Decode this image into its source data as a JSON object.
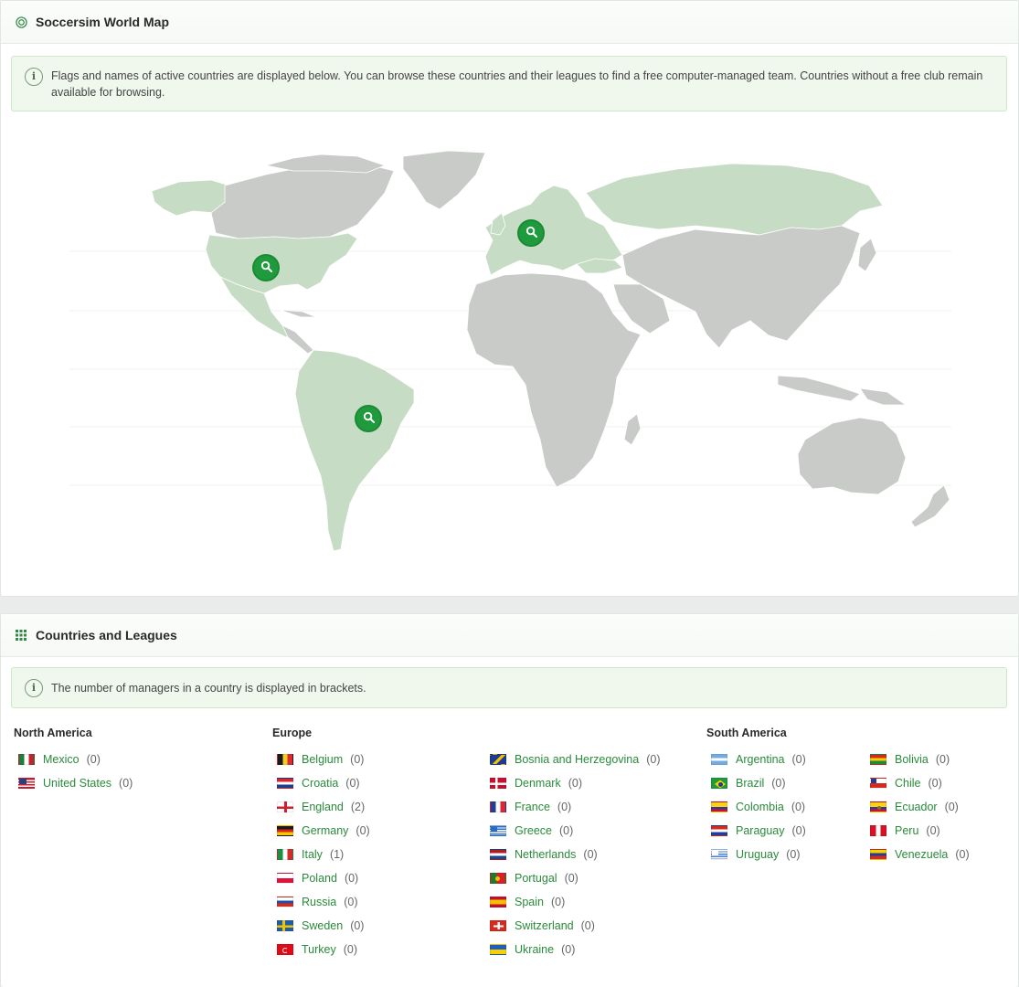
{
  "map_card": {
    "title": "Soccersim World Map",
    "info": "Flags and names of active countries are displayed below. You can browse these countries and their leagues to find a free computer-managed team. Countries without a free club remain available for browsing."
  },
  "list_card": {
    "title": "Countries and Leagues",
    "info": "The number of managers in a country is displayed in brackets."
  },
  "regions": {
    "north_america": {
      "title": "North America"
    },
    "europe": {
      "title": "Europe"
    },
    "south_america": {
      "title": "South America"
    }
  },
  "countries": {
    "mexico": {
      "name": "Mexico",
      "count": "(0)"
    },
    "united_states": {
      "name": "United States",
      "count": "(0)"
    },
    "belgium": {
      "name": "Belgium",
      "count": "(0)"
    },
    "croatia": {
      "name": "Croatia",
      "count": "(0)"
    },
    "england": {
      "name": "England",
      "count": "(2)"
    },
    "germany": {
      "name": "Germany",
      "count": "(0)"
    },
    "italy": {
      "name": "Italy",
      "count": "(1)"
    },
    "poland": {
      "name": "Poland",
      "count": "(0)"
    },
    "russia": {
      "name": "Russia",
      "count": "(0)"
    },
    "sweden": {
      "name": "Sweden",
      "count": "(0)"
    },
    "turkey": {
      "name": "Turkey",
      "count": "(0)"
    },
    "bosnia": {
      "name": "Bosnia and Herzegovina",
      "count": "(0)"
    },
    "denmark": {
      "name": "Denmark",
      "count": "(0)"
    },
    "france": {
      "name": "France",
      "count": "(0)"
    },
    "greece": {
      "name": "Greece",
      "count": "(0)"
    },
    "netherlands": {
      "name": "Netherlands",
      "count": "(0)"
    },
    "portugal": {
      "name": "Portugal",
      "count": "(0)"
    },
    "spain": {
      "name": "Spain",
      "count": "(0)"
    },
    "switzerland": {
      "name": "Switzerland",
      "count": "(0)"
    },
    "ukraine": {
      "name": "Ukraine",
      "count": "(0)"
    },
    "argentina": {
      "name": "Argentina",
      "count": "(0)"
    },
    "brazil": {
      "name": "Brazil",
      "count": "(0)"
    },
    "colombia": {
      "name": "Colombia",
      "count": "(0)"
    },
    "paraguay": {
      "name": "Paraguay",
      "count": "(0)"
    },
    "uruguay": {
      "name": "Uruguay",
      "count": "(0)"
    },
    "bolivia": {
      "name": "Bolivia",
      "count": "(0)"
    },
    "chile": {
      "name": "Chile",
      "count": "(0)"
    },
    "ecuador": {
      "name": "Ecuador",
      "count": "(0)"
    },
    "peru": {
      "name": "Peru",
      "count": "(0)"
    },
    "venezuela": {
      "name": "Venezuela",
      "count": "(0)"
    }
  },
  "colors": {
    "accent": "#1f9a3c",
    "active_land": "#c7dcc4",
    "inactive_land": "#c9cbc9",
    "link": "#2a8a3a"
  },
  "icons": {
    "map_header": "radio-target-icon",
    "list_header": "grid-table-icon",
    "info": "info-icon",
    "marker": "search-icon"
  }
}
